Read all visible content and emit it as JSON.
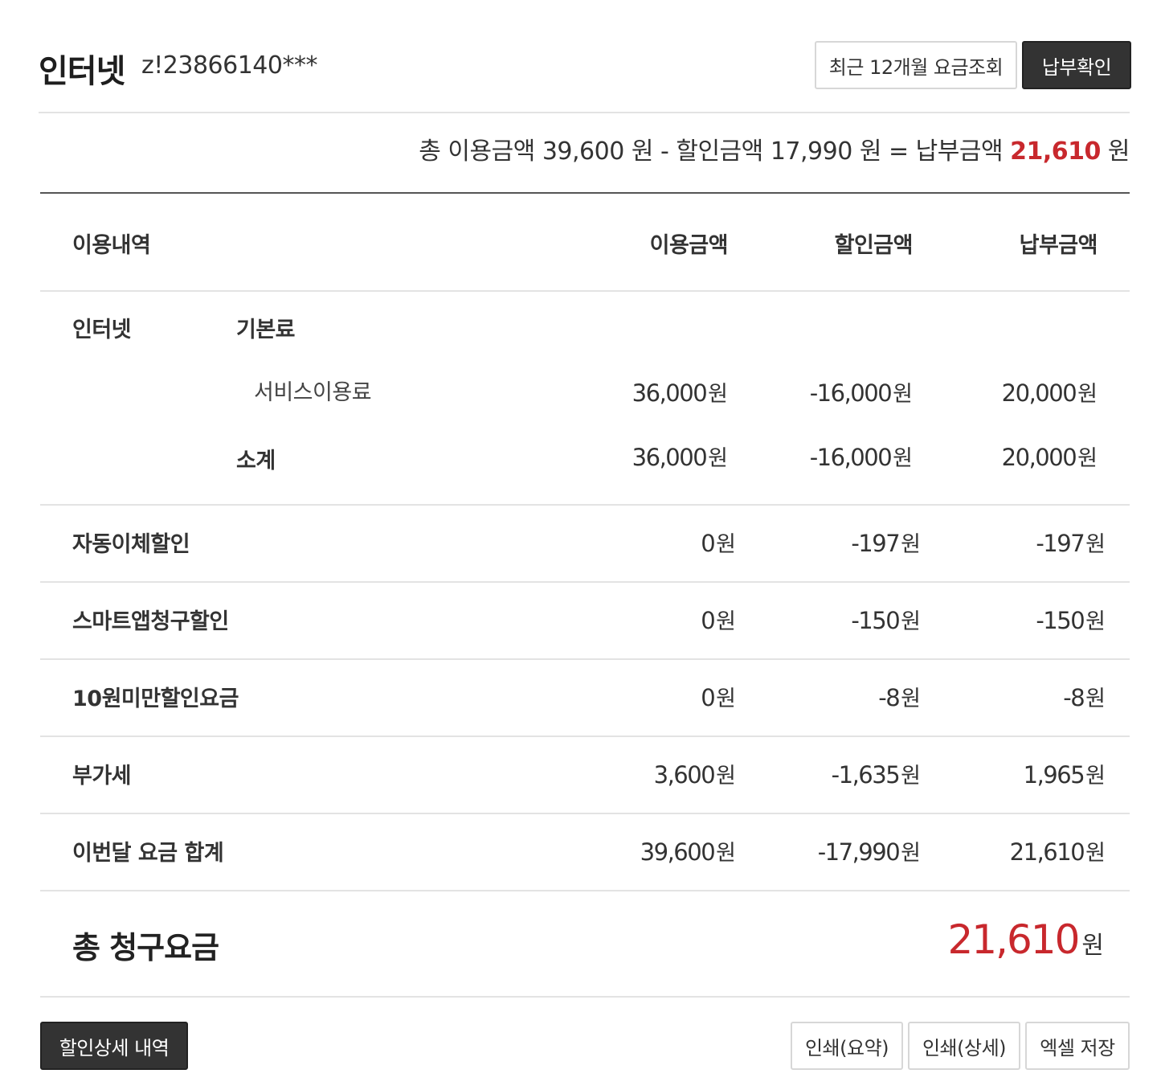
{
  "header": {
    "title": "인터넷",
    "account": "z!23866140***",
    "history_button": "최근 12개월 요금조회",
    "payment_button": "납부확인"
  },
  "summary": {
    "prefix": "총 이용금액 ",
    "usage_amount": "39,600",
    "mid1": " 원 - 할인금액 ",
    "discount_amount": "17,990",
    "mid2": " 원 = 납부금액 ",
    "payment_amount": "21,610",
    "suffix": " 원"
  },
  "table": {
    "headers": {
      "item": "이용내역",
      "usage": "이용금액",
      "discount": "할인금액",
      "payment": "납부금액"
    },
    "unit": "원",
    "internet_group": {
      "label": "인터넷",
      "basic_fee_label": "기본료",
      "service_row": {
        "label": "서비스이용료",
        "usage": "36,000",
        "discount": "-16,000",
        "payment": "20,000"
      },
      "subtotal_row": {
        "label": "소계",
        "usage": "36,000",
        "discount": "-16,000",
        "payment": "20,000"
      }
    },
    "rows": [
      {
        "label": "자동이체할인",
        "usage": "0",
        "discount": "-197",
        "payment": "-197"
      },
      {
        "label": "스마트앱청구할인",
        "usage": "0",
        "discount": "-150",
        "payment": "-150"
      },
      {
        "label": "10원미만할인요금",
        "usage": "0",
        "discount": "-8",
        "payment": "-8"
      },
      {
        "label": "부가세",
        "usage": "3,600",
        "discount": "-1,635",
        "payment": "1,965"
      },
      {
        "label": "이번달 요금 합계",
        "usage": "39,600",
        "discount": "-17,990",
        "payment": "21,610"
      }
    ]
  },
  "total": {
    "label": "총 청구요금",
    "amount": "21,610",
    "unit": "원"
  },
  "footer": {
    "discount_detail_button": "할인상세 내역",
    "print_summary_button": "인쇄(요약)",
    "print_detail_button": "인쇄(상세)",
    "excel_button": "엑셀 저장"
  },
  "colors": {
    "accent_red": "#c8282d",
    "dark_button": "#333333",
    "divider": "#e3e3e3"
  }
}
